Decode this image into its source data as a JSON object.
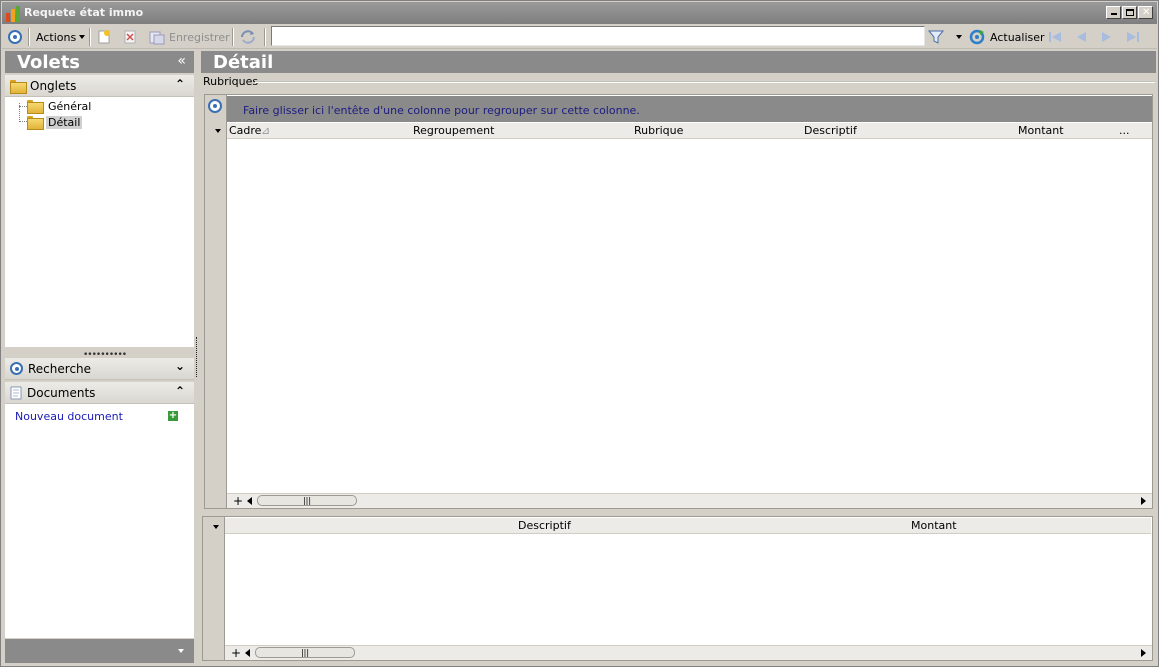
{
  "window": {
    "title": "Requete état immo"
  },
  "toolbar": {
    "actions_label": "Actions",
    "save_label": "Enregistrer",
    "search_value": "",
    "refresh_label": "Actualiser"
  },
  "left_panel": {
    "header": "Volets",
    "collapse_glyph": "«",
    "onglets": {
      "label": "Onglets",
      "items": [
        {
          "label": "Général"
        },
        {
          "label": "Détail"
        }
      ],
      "selected": "Détail"
    },
    "recherche": {
      "label": "Recherche"
    },
    "documents": {
      "label": "Documents",
      "new_doc_label": "Nouveau document"
    }
  },
  "main": {
    "header": "Détail",
    "section_label": "Rubriques",
    "grid1": {
      "group_hint": "Faire glisser ici l'entête d'une colonne pour regrouper sur cette colonne.",
      "columns": [
        "Cadre",
        "Regroupement",
        "Rubrique",
        "Descriptif",
        "Montant",
        "..."
      ]
    },
    "grid2": {
      "columns": [
        "Descriptif",
        "Montant"
      ]
    }
  },
  "colors": {
    "header_gray": "#8a8a8a",
    "link_blue": "#1a1ab8",
    "accent_blue": "#3a6fb3"
  }
}
